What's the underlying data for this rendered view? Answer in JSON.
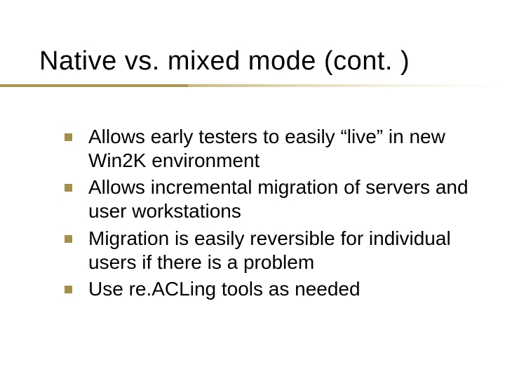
{
  "title": "Native vs. mixed mode (cont. )",
  "bullets": [
    "Allows early testers to easily “live” in new Win2K environment",
    "Allows incremental migration of servers and user workstations",
    "Migration is easily reversible for individual users if there is a problem",
    "Use re.ACLing tools as needed"
  ]
}
